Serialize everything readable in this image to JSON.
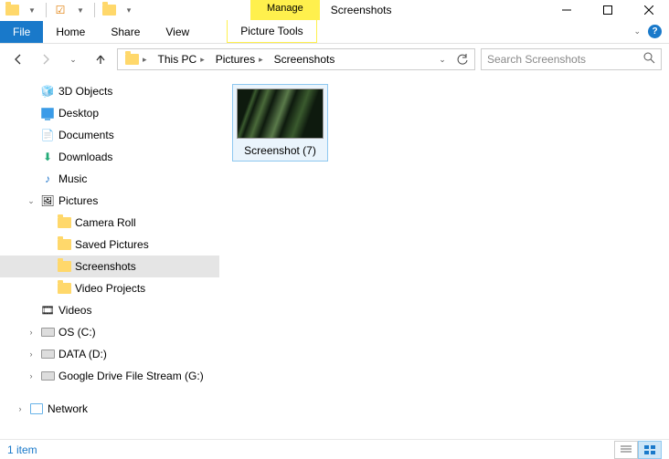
{
  "title": "Screenshots",
  "context_tab": {
    "group": "Manage",
    "tab": "Picture Tools"
  },
  "ribbon_tabs": {
    "file": "File",
    "home": "Home",
    "share": "Share",
    "view": "View"
  },
  "breadcrumb": [
    "This PC",
    "Pictures",
    "Screenshots"
  ],
  "search_placeholder": "Search Screenshots",
  "tree": {
    "three_d": "3D Objects",
    "desktop": "Desktop",
    "documents": "Documents",
    "downloads": "Downloads",
    "music": "Music",
    "pictures": "Pictures",
    "camera_roll": "Camera Roll",
    "saved_pictures": "Saved Pictures",
    "screenshots": "Screenshots",
    "video_projects": "Video Projects",
    "videos": "Videos",
    "os_c": "OS (C:)",
    "data_d": "DATA (D:)",
    "gdrive": "Google Drive File Stream (G:)",
    "network": "Network"
  },
  "files": [
    {
      "name": "Screenshot (7)"
    }
  ],
  "status": "1 item"
}
